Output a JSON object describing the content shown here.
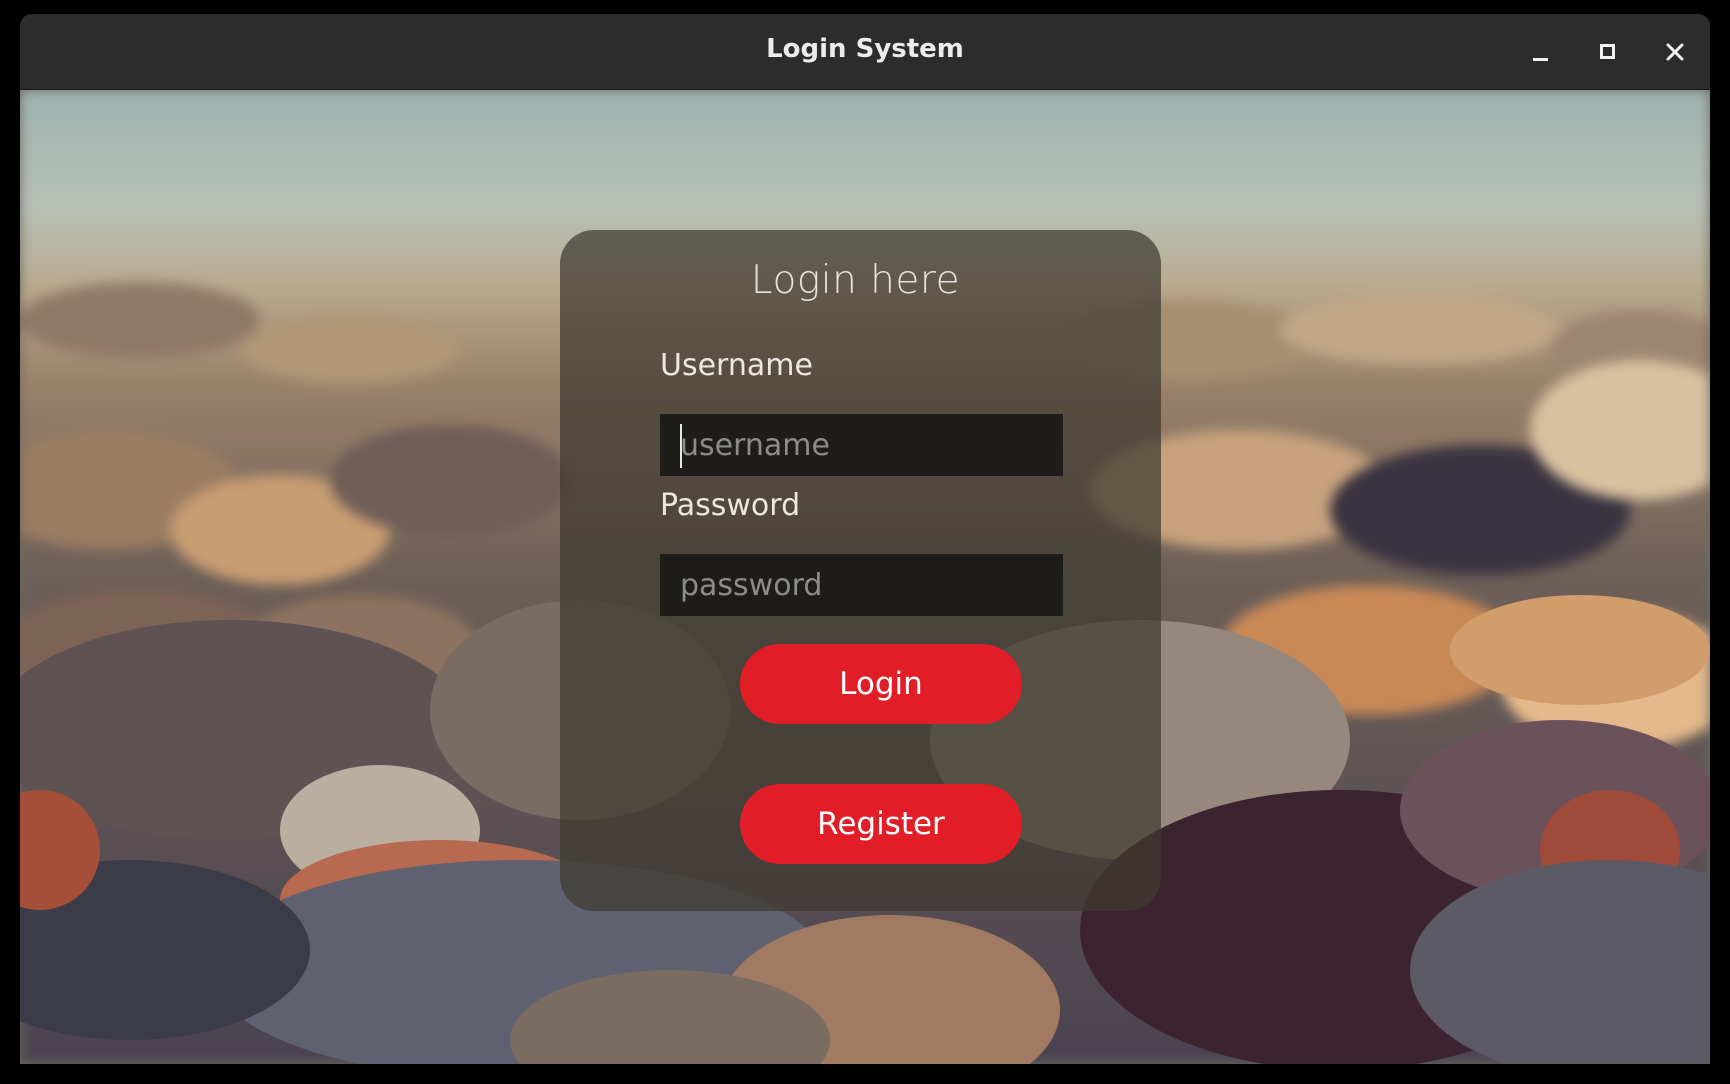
{
  "window": {
    "title": "Login System",
    "controls": {
      "minimize_icon": "minimize-icon",
      "maximize_icon": "maximize-icon",
      "close_icon": "close-icon"
    }
  },
  "form": {
    "heading": "Login here",
    "username": {
      "label": "Username",
      "placeholder": "username",
      "value": ""
    },
    "password": {
      "label": "Password",
      "placeholder": "password",
      "value": ""
    },
    "login_label": "Login",
    "register_label": "Register"
  },
  "colors": {
    "accent": "#e11e27",
    "titlebar": "#2c2c2c",
    "panel": "#3e3a30"
  }
}
